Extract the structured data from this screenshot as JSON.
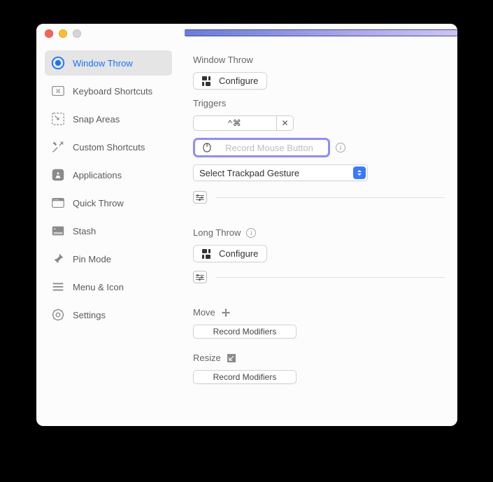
{
  "sidebar": {
    "items": [
      {
        "label": "Window Throw"
      },
      {
        "label": "Keyboard Shortcuts"
      },
      {
        "label": "Snap Areas"
      },
      {
        "label": "Custom Shortcuts"
      },
      {
        "label": "Applications"
      },
      {
        "label": "Quick Throw"
      },
      {
        "label": "Stash"
      },
      {
        "label": "Pin Mode"
      },
      {
        "label": "Menu & Icon"
      },
      {
        "label": "Settings"
      }
    ]
  },
  "content": {
    "windowThrow": {
      "title": "Window Throw",
      "configure": "Configure",
      "triggersLabel": "Triggers",
      "shortcut": "^⌘",
      "recordMousePlaceholder": "Record Mouse Button",
      "trackpadSelect": "Select Trackpad Gesture"
    },
    "longThrow": {
      "title": "Long Throw",
      "configure": "Configure"
    },
    "move": {
      "title": "Move",
      "button": "Record Modifiers"
    },
    "resize": {
      "title": "Resize",
      "button": "Record Modifiers"
    }
  }
}
